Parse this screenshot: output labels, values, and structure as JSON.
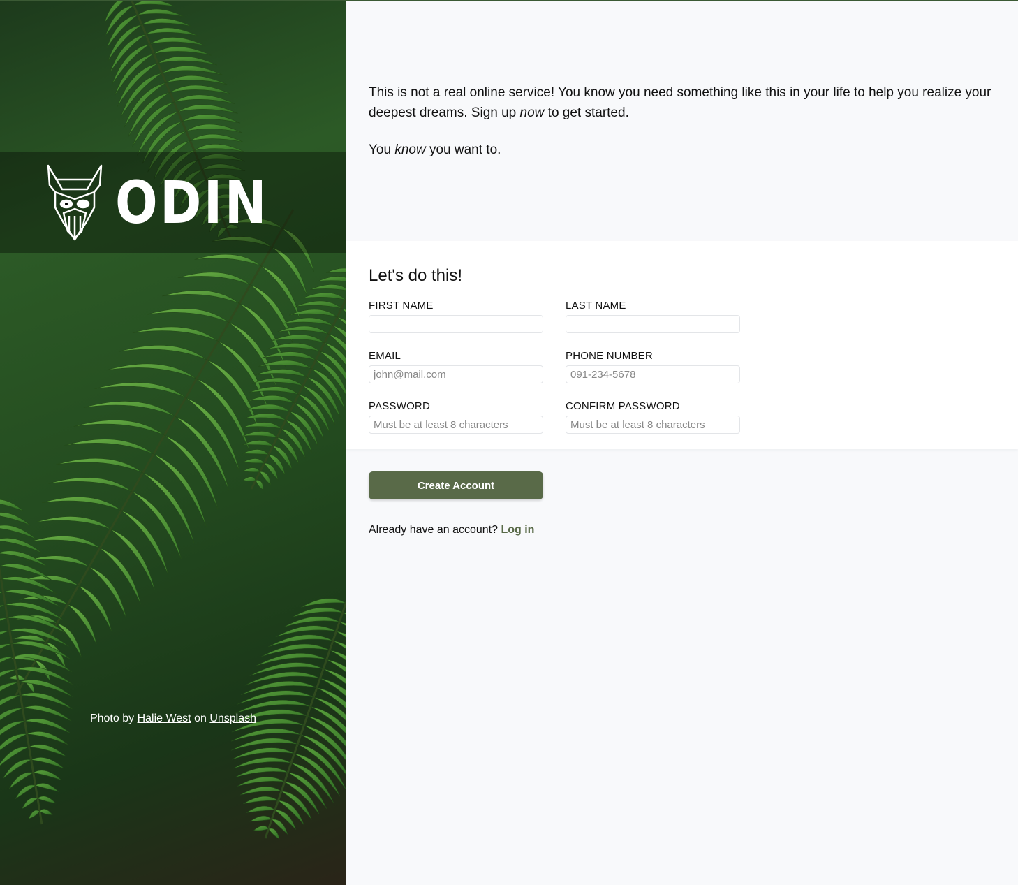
{
  "hero": {
    "brand": "ODIN",
    "credit_prefix": "Photo by",
    "credit_author": "Halie West",
    "credit_mid": "on",
    "credit_source": "Unsplash"
  },
  "intro": {
    "p1_a": "This is not a real online service! You know you need something like this in your life to help you realize your deepest dreams. Sign up ",
    "p1_em": "now",
    "p1_b": " to get started.",
    "p2_a": "You ",
    "p2_em": "know",
    "p2_b": " you want to."
  },
  "form": {
    "title": "Let's do this!",
    "fields": [
      {
        "label": "FIRST NAME",
        "placeholder": "",
        "type": "text"
      },
      {
        "label": "LAST NAME",
        "placeholder": "",
        "type": "text"
      },
      {
        "label": "EMAIL",
        "placeholder": "john@mail.com",
        "type": "email"
      },
      {
        "label": "PHONE NUMBER",
        "placeholder": "091-234-5678",
        "type": "tel"
      },
      {
        "label": "PASSWORD",
        "placeholder": "Must be at least 8 characters",
        "type": "password"
      },
      {
        "label": "CONFIRM PASSWORD",
        "placeholder": "Must be at least 8 characters",
        "type": "password"
      }
    ]
  },
  "cta": {
    "button_label": "Create Account",
    "login_prompt": "Already have an account?",
    "login_link": "Log in"
  },
  "colors": {
    "accent": "#596a48",
    "top_line": "#3b5a34",
    "background": "#f8f9fb"
  }
}
